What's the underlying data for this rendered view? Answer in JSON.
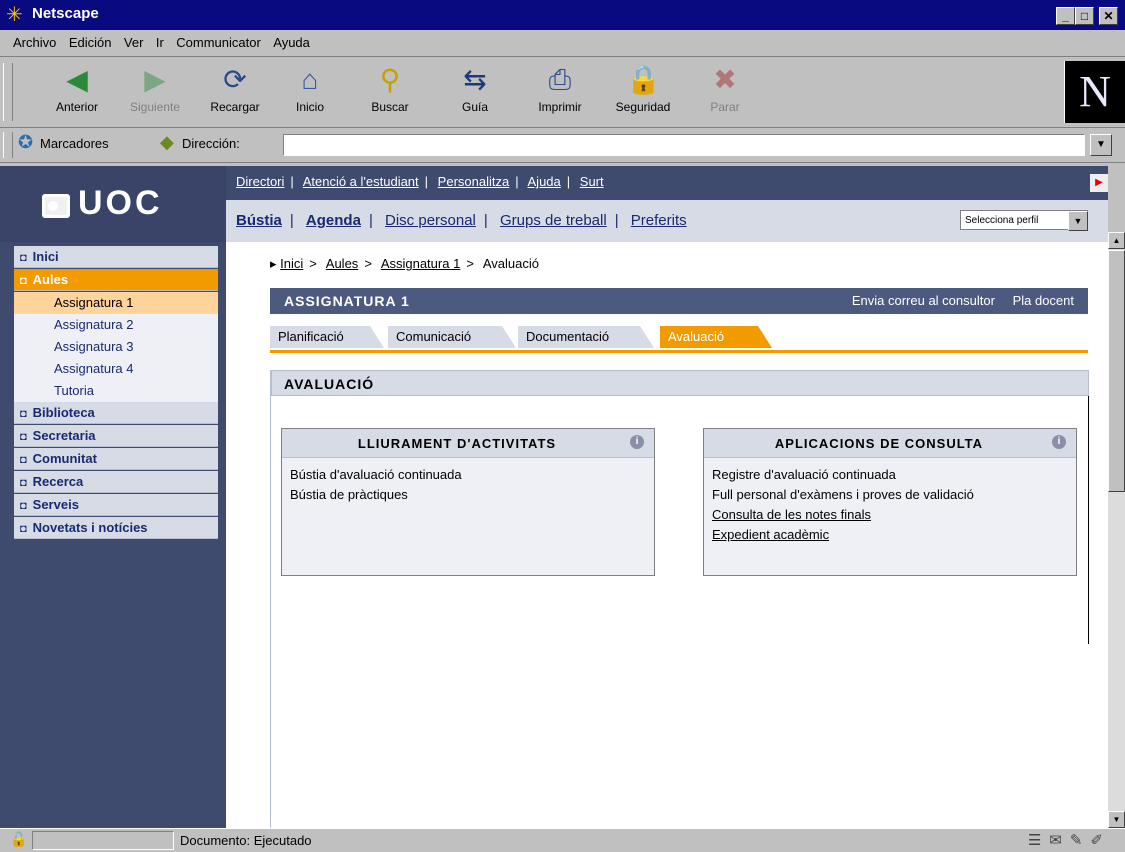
{
  "window": {
    "title": "Netscape"
  },
  "menu": [
    "Archivo",
    "Edición",
    "Ver",
    "Ir",
    "Communicator",
    "Ayuda"
  ],
  "toolbar": [
    {
      "label": "Anterior",
      "icon": "back-icon",
      "enabled": true
    },
    {
      "label": "Siguiente",
      "icon": "forward-icon",
      "enabled": false
    },
    {
      "label": "Recargar",
      "icon": "reload-icon",
      "enabled": true
    },
    {
      "label": "Inicio",
      "icon": "home-icon",
      "enabled": true
    },
    {
      "label": "Buscar",
      "icon": "search-icon",
      "enabled": true
    },
    {
      "label": "Guía",
      "icon": "guide-icon",
      "enabled": true
    },
    {
      "label": "Imprimir",
      "icon": "print-icon",
      "enabled": true
    },
    {
      "label": "Seguridad",
      "icon": "security-icon",
      "enabled": true
    },
    {
      "label": "Parar",
      "icon": "stop-icon",
      "enabled": false
    }
  ],
  "location": {
    "bookmarks_label": "Marcadores",
    "address_label": "Dirección:",
    "url": ""
  },
  "uoc": {
    "logo": "UOC",
    "top_links": [
      "Directori",
      "Atenció a l'estudiant",
      "Personalitza",
      "Ajuda",
      "Surt"
    ],
    "sub_links": [
      "Bústia",
      "Agenda",
      "Disc personal",
      "Grups de treball",
      "Preferits"
    ],
    "profile_select": "Selecciona perfil"
  },
  "nav": [
    {
      "label": "Inici",
      "type": "main"
    },
    {
      "label": "Aules",
      "type": "main",
      "active": true
    },
    {
      "label": "Assignatura 1",
      "type": "sub",
      "selected": true
    },
    {
      "label": "Assignatura 2",
      "type": "sub"
    },
    {
      "label": "Assignatura 3",
      "type": "sub"
    },
    {
      "label": "Assignatura 4",
      "type": "sub"
    },
    {
      "label": "Tutoria",
      "type": "sub"
    },
    {
      "label": "Biblioteca",
      "type": "main"
    },
    {
      "label": "Secretaria",
      "type": "main"
    },
    {
      "label": "Comunitat",
      "type": "main"
    },
    {
      "label": "Recerca",
      "type": "main"
    },
    {
      "label": "Serveis",
      "type": "main"
    },
    {
      "label": "Novetats i notícies",
      "type": "main"
    }
  ],
  "breadcrumb": [
    "Inici",
    "Aules",
    "Assignatura 1",
    "Avaluació"
  ],
  "assignatura": {
    "title": "ASSIGNATURA 1",
    "right_links": [
      "Envia correu al consultor",
      "Pla docent"
    ]
  },
  "tabs": [
    "Planificació",
    "Comunicació",
    "Documentació",
    "Avaluació"
  ],
  "active_tab": "Avaluació",
  "section_title": "AVALUACIÓ",
  "boxes": [
    {
      "title": "LLIURAMENT D'ACTIVITATS",
      "items": [
        "Bústia d'avaluació continuada",
        "Bústia de pràctiques"
      ],
      "links": [
        false,
        false
      ]
    },
    {
      "title": "APLICACIONS DE CONSULTA",
      "items": [
        "Registre d'avaluació continuada",
        "Full personal d'exàmens i proves de validació",
        "Consulta de les notes finals",
        "Expedient acadèmic"
      ],
      "links": [
        false,
        false,
        true,
        true
      ]
    }
  ],
  "status": {
    "text": "Documento: Ejecutado"
  },
  "colors": {
    "uoc_navy": "#3e4a6e",
    "accent_orange": "#f29b00",
    "panel_light": "#d6dbe6"
  }
}
